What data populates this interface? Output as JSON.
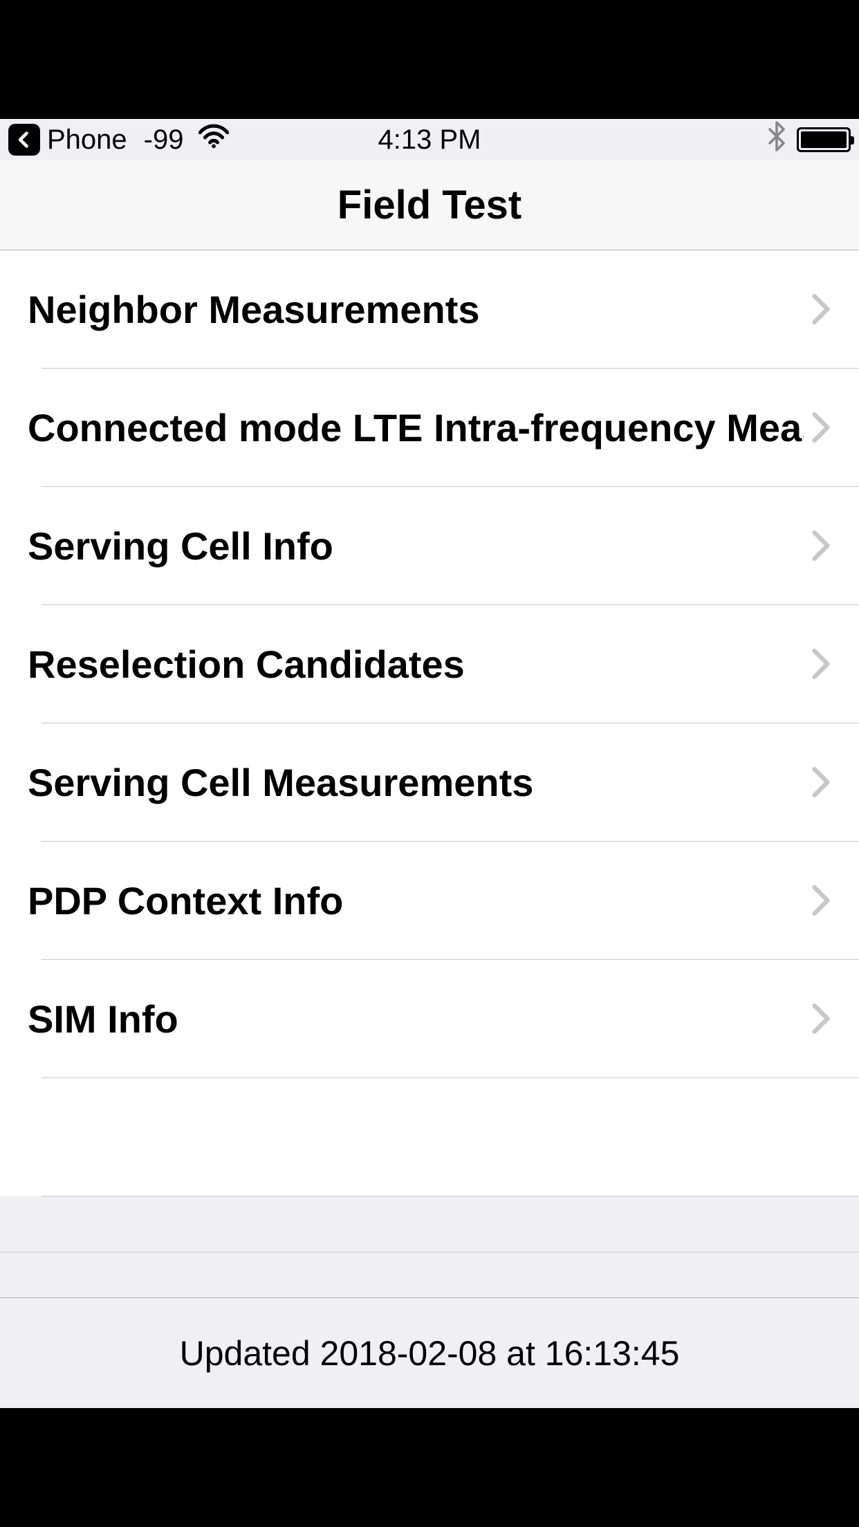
{
  "status_bar": {
    "carrier": "Phone",
    "signal": "-99",
    "time": "4:13 PM"
  },
  "nav": {
    "title": "Field Test"
  },
  "rows": [
    {
      "label": "Neighbor Measurements"
    },
    {
      "label": "Connected mode LTE Intra-frequency Measurements"
    },
    {
      "label": "Serving Cell Info"
    },
    {
      "label": "Reselection Candidates"
    },
    {
      "label": "Serving Cell Measurements"
    },
    {
      "label": "PDP Context Info"
    },
    {
      "label": "SIM Info"
    }
  ],
  "footer": {
    "text": "Updated 2018-02-08 at 16:13:45"
  }
}
